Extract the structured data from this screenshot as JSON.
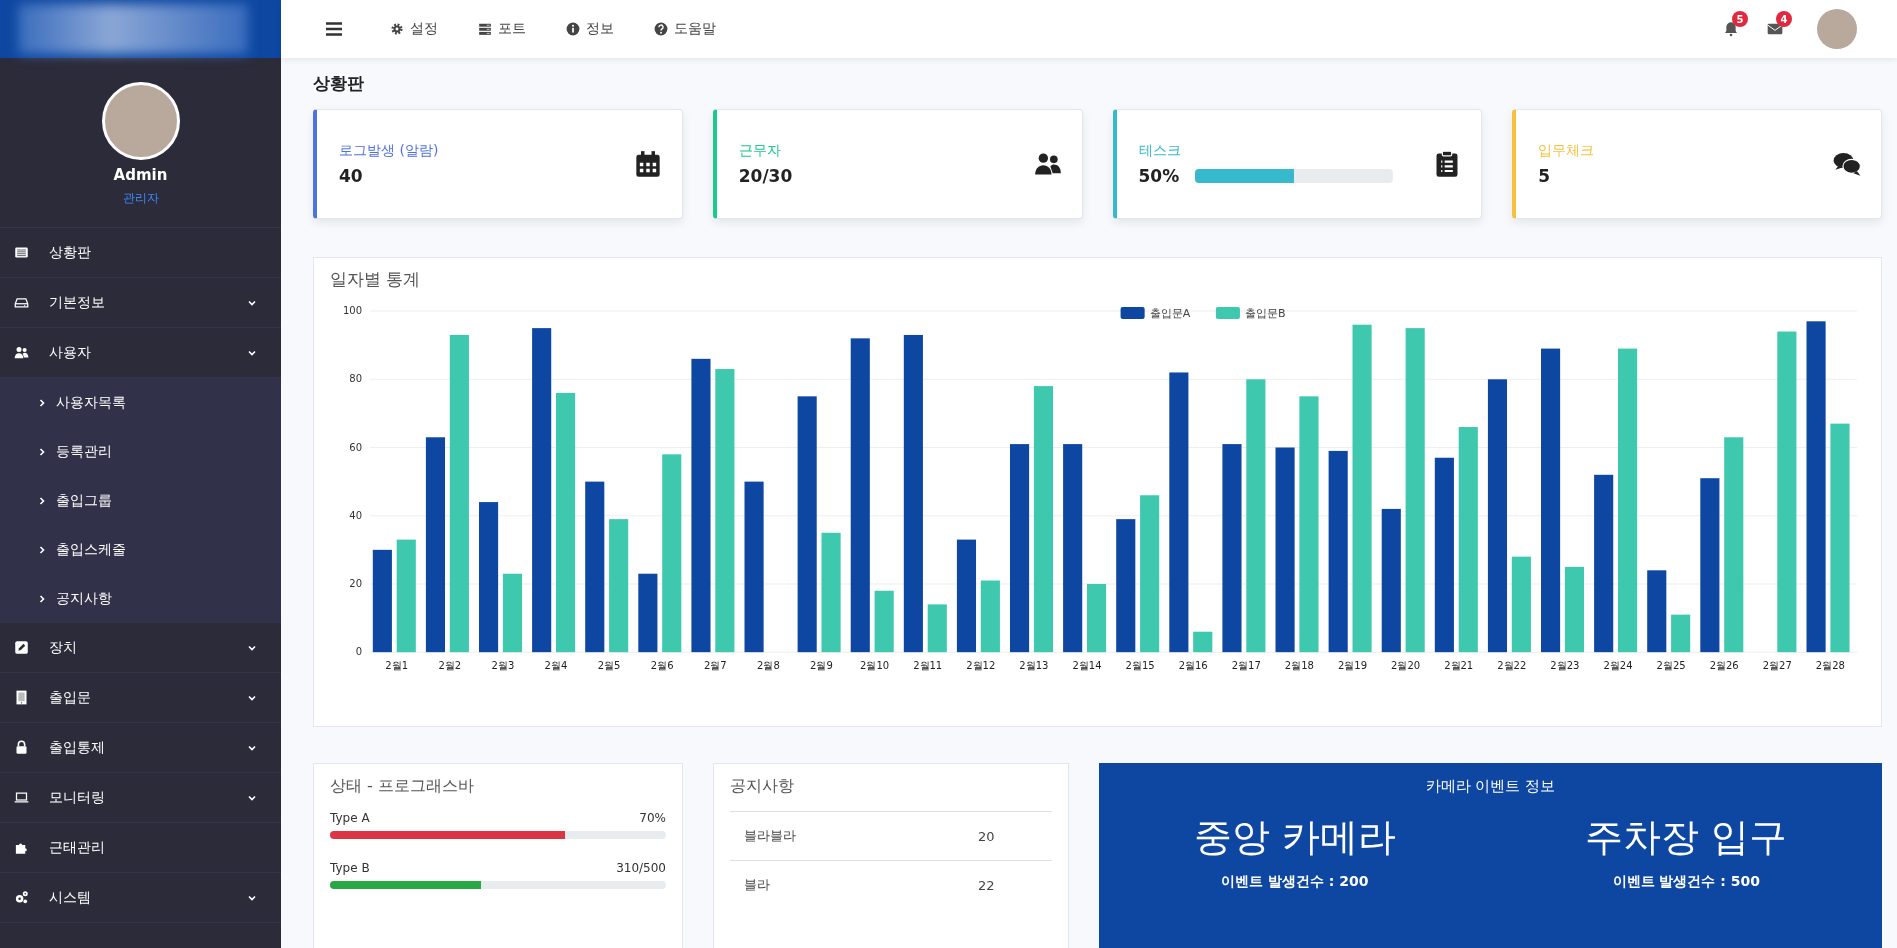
{
  "sidebar": {
    "user": {
      "name": "Admin",
      "role": "관리자"
    },
    "items": [
      {
        "label": "상황판",
        "kind": "link"
      },
      {
        "label": "기본정보",
        "kind": "group"
      },
      {
        "label": "사용자",
        "kind": "group",
        "children": [
          {
            "label": "사용자목록"
          },
          {
            "label": "등록관리"
          },
          {
            "label": "출입그룹"
          },
          {
            "label": "출입스케줄"
          },
          {
            "label": "공지사항"
          }
        ]
      },
      {
        "label": "장치",
        "kind": "group"
      },
      {
        "label": "출입문",
        "kind": "group"
      },
      {
        "label": "출입통제",
        "kind": "group"
      },
      {
        "label": "모니터링",
        "kind": "group"
      },
      {
        "label": "근태관리",
        "kind": "link"
      },
      {
        "label": "시스템",
        "kind": "group"
      }
    ]
  },
  "topbar": {
    "menu": [
      {
        "label": "설정"
      },
      {
        "label": "포트"
      },
      {
        "label": "정보"
      },
      {
        "label": "도움말"
      }
    ],
    "alerts": [
      {
        "count": "5"
      },
      {
        "count": "4"
      }
    ]
  },
  "page_title": "상황판",
  "cards": [
    {
      "kind": "value",
      "label": "로그발생 (알람)",
      "value": "40",
      "color": "#4e73df"
    },
    {
      "kind": "value",
      "label": "근무자",
      "value": "20/30",
      "color": "#1cc88a"
    },
    {
      "kind": "progress",
      "label": "테스크",
      "value": "50%",
      "level": 0.5,
      "color": "#36b9cc"
    },
    {
      "kind": "value",
      "label": "입무체크",
      "value": "5",
      "color": "#f6c23e"
    }
  ],
  "daily_chart": {
    "title": "일자별 통계",
    "chart_data": {
      "type": "bar",
      "categories": [
        "2월1",
        "2월2",
        "2월3",
        "2월4",
        "2월5",
        "2월6",
        "2월7",
        "2월8",
        "2월9",
        "2월10",
        "2월11",
        "2월12",
        "2월13",
        "2월14",
        "2월15",
        "2월16",
        "2월17",
        "2월18",
        "2월19",
        "2월20",
        "2월21",
        "2월22",
        "2월23",
        "2월24",
        "2월25",
        "2월26",
        "2월27",
        "2월28"
      ],
      "series": [
        {
          "name": "출입문A",
          "color": "#0d47a1",
          "values": [
            30,
            63,
            44,
            95,
            50,
            23,
            86,
            50,
            75,
            92,
            93,
            33,
            61,
            61,
            39,
            82,
            61,
            60,
            59,
            42,
            57,
            80,
            89,
            52,
            24,
            51,
            null,
            97
          ]
        },
        {
          "name": "출입문B",
          "color": "#3ec8ae",
          "values": [
            33,
            93,
            23,
            76,
            39,
            58,
            83,
            null,
            35,
            18,
            14,
            21,
            78,
            20,
            46,
            6,
            80,
            75,
            96,
            95,
            66,
            28,
            25,
            89,
            11,
            63,
            94,
            67
          ]
        }
      ],
      "ylim": [
        0,
        100
      ],
      "yticks": [
        0,
        20,
        40,
        60,
        80,
        100
      ],
      "grid": true,
      "legend": true
    }
  },
  "progress_panel": {
    "title": "상태 - 프로그래스바",
    "bars": [
      {
        "label": "Type A",
        "reading": "70%",
        "level": 0.7,
        "color": "#dc3545"
      },
      {
        "label": "Type B",
        "reading": "310/500",
        "level": 0.45,
        "color": "#28a745"
      }
    ]
  },
  "notice_panel": {
    "title": "공지사항",
    "rows": [
      {
        "title": "블라블라",
        "count": "20"
      },
      {
        "title": "블라",
        "count": "22"
      }
    ]
  },
  "camera_panel": {
    "title": "카메라 이벤트 정보",
    "cameras": [
      {
        "name": "중앙 카메라",
        "events": "이벤트 발생건수 : 200"
      },
      {
        "name": "주차장 입구",
        "events": "이벤트 발생건수 : 500"
      }
    ]
  }
}
